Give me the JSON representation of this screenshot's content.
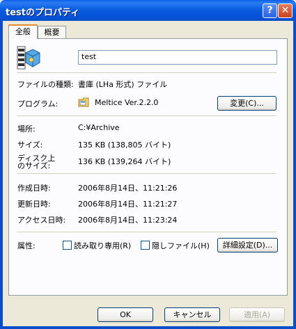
{
  "window": {
    "title": "testのプロパティ",
    "help_glyph": "?",
    "close_glyph": "✕"
  },
  "tabs": [
    {
      "label": "全般",
      "active": true
    },
    {
      "label": "概要",
      "active": false
    }
  ],
  "general": {
    "filename": "test",
    "type_label": "ファイルの種類:",
    "type_value": "書庫 (LHa 形式) ファイル",
    "program_label": "プログラム:",
    "program_value": "Meltice Ver.2.2.0",
    "change_button": "変更(C)...",
    "location_label": "場所:",
    "location_value": "C:¥Archive",
    "size_label": "サイズ:",
    "size_value": "135 KB (138,805 バイト)",
    "disk_size_label_1": "ディスク上",
    "disk_size_label_2": "のサイズ:",
    "disk_size_value": "136 KB (139,264 バイト)",
    "created_label": "作成日時:",
    "created_value": "2006年8月14日、11:21:26",
    "modified_label": "更新日時:",
    "modified_value": "2006年8月14日、11:21:27",
    "accessed_label": "アクセス日時:",
    "accessed_value": "2006年8月14日、11:23:24",
    "attributes_label": "属性:",
    "readonly_label": "読み取り専用(R)",
    "readonly_checked": false,
    "hidden_label": "隠しファイル(H)",
    "hidden_checked": false,
    "advanced_button": "詳細設定(D)..."
  },
  "footer": {
    "ok": "OK",
    "cancel": "キャンセル",
    "apply": "適用(A)"
  },
  "icons": {
    "file_icon": "archive-file-icon",
    "program_icon": "meltice-app-icon"
  },
  "colors": {
    "titlebar": "#0A5FE8",
    "dialog_bg": "#ECE9D8",
    "panel_bg": "#FCFCFE",
    "tab_accent": "#E68B2C"
  }
}
